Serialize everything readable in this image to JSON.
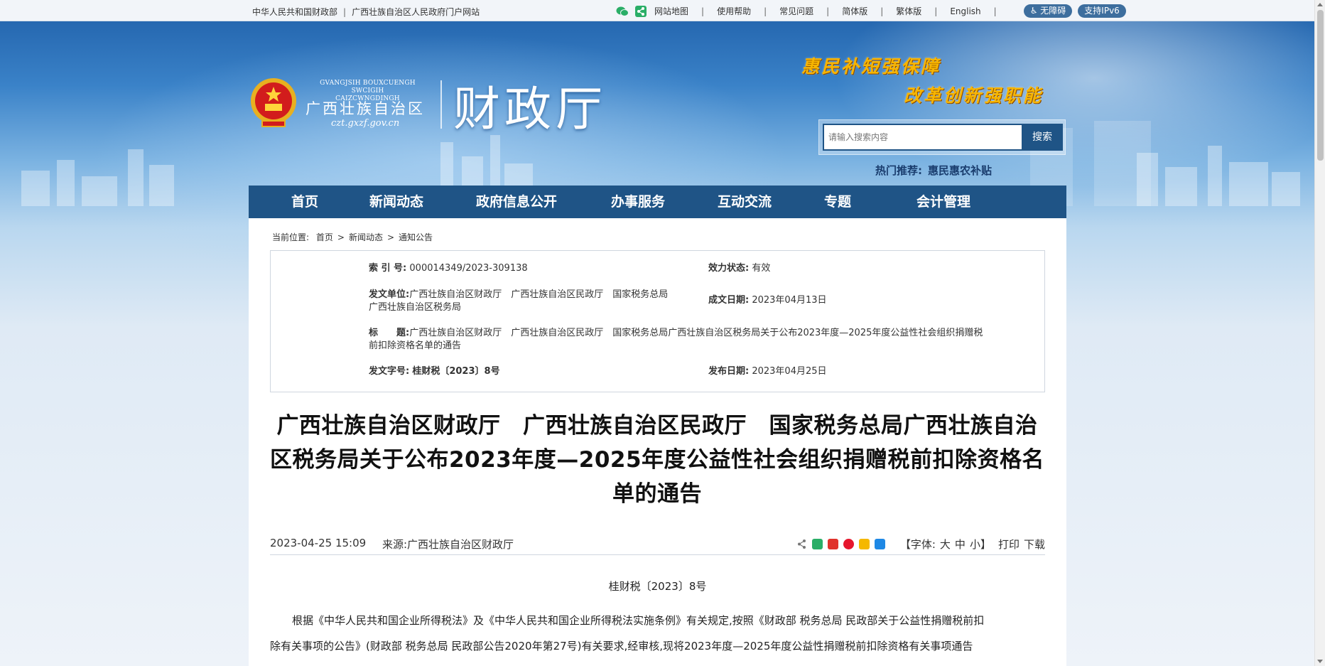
{
  "topbar": {
    "links_left": [
      "中华人民共和国财政部",
      "广西壮族自治区人民政府门户网站"
    ],
    "links_right": [
      "网站地图",
      "使用帮助",
      "常见问题",
      "简体版",
      "繁体版",
      "English"
    ],
    "accessibility": "无障碍",
    "ipv6": "支持IPv6"
  },
  "header": {
    "logo_en_line1": "GVANGJSIH BOUXCUENGH SWCIGIH",
    "logo_en_line2": "CAIZCWNGDINGH",
    "logo_cn": "广西壮族自治区",
    "logo_url": "czt.gxzf.gov.cn",
    "site_title": "财政厅",
    "slogan1": "惠民补短强保障",
    "slogan2": "改革创新强职能"
  },
  "search": {
    "placeholder": "请输入搜索内容",
    "button": "搜索",
    "hot_label": "热门推荐:",
    "hot_keyword": "惠民惠农补贴"
  },
  "nav": {
    "items": [
      "首页",
      "新闻动态",
      "政府信息公开",
      "办事服务",
      "互动交流",
      "专题",
      "会计管理"
    ]
  },
  "breadcrumb": {
    "label": "当前位置:",
    "items": [
      "首页",
      "新闻动态",
      "通知公告"
    ],
    "sep": ">"
  },
  "meta": {
    "index_label": "索 引 号:",
    "index_value": "000014349/2023-309138",
    "status_label": "效力状态:",
    "status_value": "有效",
    "issuer_label": "发文单位:",
    "issuer_value_line1": "广西壮族自治区财政厅　广西壮族自治区民政厅　国家税务总局",
    "issuer_value_line2": "广西壮族自治区税务局",
    "created_label": "成文日期:",
    "created_value": "2023年04月13日",
    "title_label": "标　　题:",
    "title_value_line1": "广西壮族自治区财政厅　广西壮族自治区民政厅　国家税务总局广西壮族自治区税务局关于公布2023年度—2025年度公益性社会组织捐赠税",
    "title_value_line2": "前扣除资格名单的通告",
    "docno_label": "发文字号:",
    "docno_value": "桂财税〔2023〕8号",
    "published_label": "发布日期:",
    "published_value": "2023年04月25日"
  },
  "article": {
    "title_line1": "广西壮族自治区财政厅　广西壮族自治区民政厅　国家税务总局广西壮族自治",
    "title_line2": "区税务局关于公布2023年度—2025年度公益性社会组织捐赠税前扣除资格名",
    "title_line3": "单的通告",
    "datetime": "2023-04-25 15:09",
    "source": "来源:广西壮族自治区财政厅",
    "font_label": "【字体:",
    "font_large": "大",
    "font_medium": "中",
    "font_small": "小",
    "font_close": "】",
    "print": "打印",
    "download": "下载",
    "doc_number": "桂财税〔2023〕8号",
    "para1_line1": "根据《中华人民共和国企业所得税法》及《中华人民共和国企业所得税法实施条例》有关规定,按照《财政部 税务总局 民政部关于公益性捐赠税前扣",
    "para1_line2": "除有关事项的公告》(财政部 税务总局 民政部公告2020年第27号)有关要求,经审核,现将2023年度—2025年度公益性捐赠税前扣除资格有关事项通告"
  },
  "colors": {
    "nav_bg": "#1f5486",
    "slogan": "#f7b500",
    "pill": "#3d6e9e"
  }
}
